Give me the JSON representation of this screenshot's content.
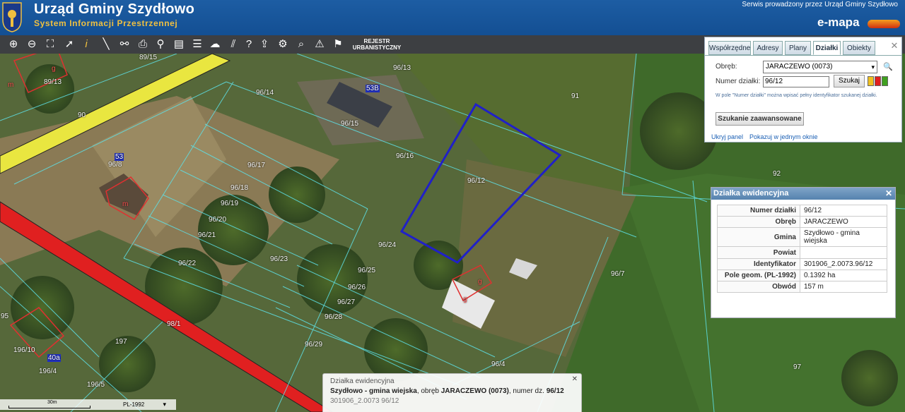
{
  "header": {
    "title": "Urząd Gminy Szydłowo",
    "subtitle": "System Informacji Przestrzennej",
    "service": "Serwis prowadzony przez Urząd Gminy Szydłowo",
    "brand": "e-mapa"
  },
  "toolbar": {
    "icons": [
      "zoom-in-icon",
      "zoom-out-icon",
      "zoom-extent-icon",
      "pointer-icon",
      "info-icon",
      "measure-icon",
      "link-icon",
      "print-icon",
      "pin-icon",
      "table-icon",
      "layers-icon",
      "comment-icon",
      "hatch-icon",
      "help-icon",
      "upload-icon",
      "settings-icon",
      "find-icon",
      "warning-icon",
      "marker-icon"
    ],
    "rejestr_label": "REJESTR URBANISTYCZNY"
  },
  "search_panel": {
    "tabs": [
      "Współrzędne",
      "Adresy",
      "Plany",
      "Działki",
      "Obiekty"
    ],
    "active_tab": "Działki",
    "obreb_label": "Obręb:",
    "obreb_value": "JARACZEWO (0073)",
    "numer_label": "Numer działki:",
    "numer_value": "96/12",
    "szukaj_label": "Szukaj",
    "hint": "W pole \"Numer działki\" można wpisać pełny identyfikator szukanej działki.",
    "advanced_label": "Szukanie zaawansowane",
    "hide_label": "Ukryj panel",
    "single_window_label": "Pokazuj w jednym oknie",
    "swatch_colors": [
      "#f0c020",
      "#e02020",
      "#40a020"
    ]
  },
  "info_popup": {
    "title": "Działka ewidencyjna",
    "rows": [
      {
        "key": "Numer działki",
        "value": "96/12"
      },
      {
        "key": "Obręb",
        "value": "JARACZEWO"
      },
      {
        "key": "Gmina",
        "value": "Szydłowo - gmina wiejska"
      },
      {
        "key": "Powiat",
        "value": ""
      },
      {
        "key": "Identyfikator",
        "value": "301906_2.0073.96/12"
      },
      {
        "key": "Pole geom. (PL-1992)",
        "value": "0.1392 ha"
      },
      {
        "key": "Obwód",
        "value": "157 m"
      }
    ]
  },
  "tooltip": {
    "title": "Działka ewidencyjna",
    "gmina": "Szydłowo - gmina wiejska",
    "obreb_prefix": ", obręb ",
    "obreb": "JARACZEWO (0073)",
    "numer_prefix": ", numer dz. ",
    "numer": "96/12",
    "identifier": "301906_2.0073 96/12"
  },
  "map": {
    "parcel_labels": [
      "89/15",
      "89/13",
      "90",
      "96/13",
      "96/14",
      "91",
      "96/15",
      "96/16",
      "96/8",
      "96/17",
      "96/18",
      "96/19",
      "96/20",
      "96/21",
      "96/22",
      "96/12",
      "92",
      "96/24",
      "96/23",
      "96/25",
      "96/26",
      "96/27",
      "96/28",
      "96/7",
      "95",
      "98/1",
      "197",
      "96/29",
      "196/10",
      "196/4",
      "96/4",
      "97",
      "196/5"
    ],
    "building_labels": [
      "g",
      "m",
      "53B",
      "53",
      "m",
      "g",
      "g",
      "40a"
    ],
    "selected_parcel": "96/12",
    "selected_color": "#2020c8"
  },
  "scale": {
    "label": "30m",
    "projection": "PL-1992"
  }
}
